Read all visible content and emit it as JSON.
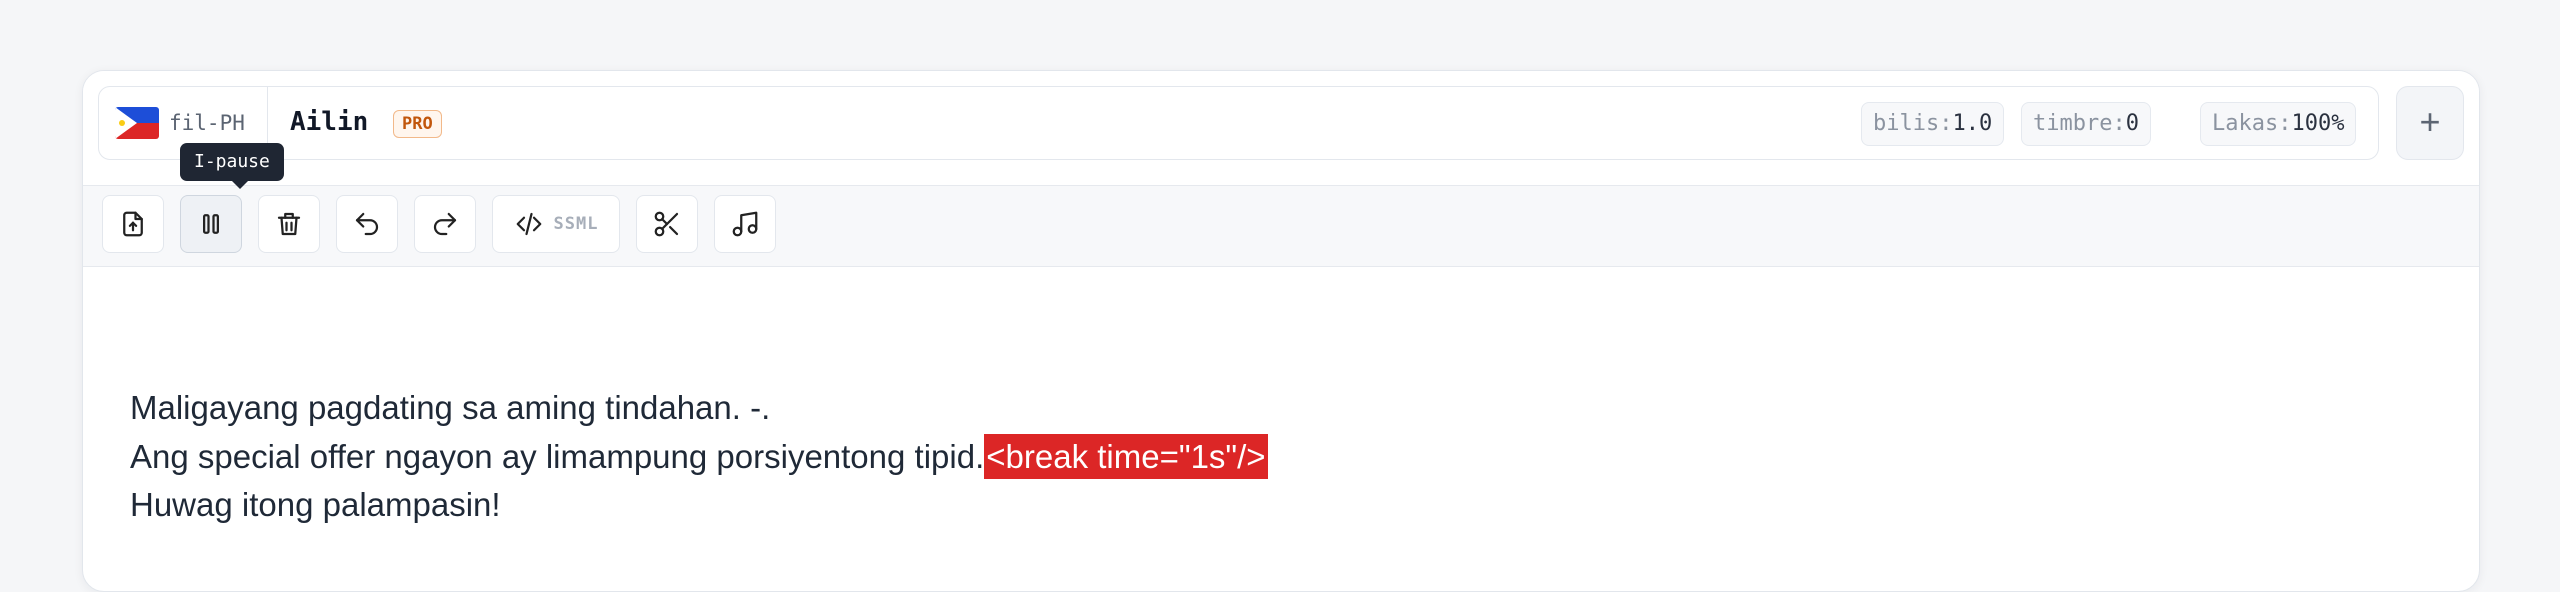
{
  "voice_bar": {
    "locale": "fil-PH",
    "flag_icon": "philippines-flag-icon",
    "voice_name": "Ailin",
    "badge": "PRO",
    "params": [
      {
        "key": "bilis:",
        "value": "1.0"
      },
      {
        "key": "timbre:",
        "value": "0"
      },
      {
        "key": "Lakas:",
        "value": "100%"
      }
    ],
    "add_label": "+"
  },
  "toolbar": {
    "tooltip": "I-pause",
    "ssml_label": "SSML",
    "buttons": [
      "upload-icon",
      "pause-icon",
      "trash-icon",
      "undo-icon",
      "redo-icon",
      "code-icon",
      "scissors-icon",
      "music-icon"
    ]
  },
  "editor": {
    "line1": "Maligayang pagdating sa aming tindahan. -.",
    "line2_text": "Ang special offer ngayon ay limampung porsiyentong tipid.",
    "line2_tag": "<break time=\"1s\"/>",
    "line3": "Huwag itong palampasin!"
  },
  "colors": {
    "accent_tag": "#dc2626",
    "pro_badge": "#c2570c",
    "tooltip_bg": "#1f2633"
  }
}
